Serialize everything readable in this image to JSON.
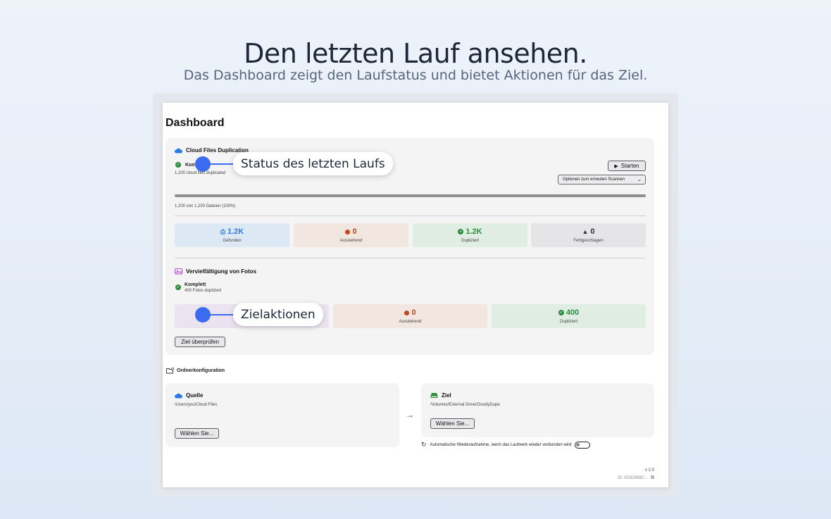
{
  "hero": {
    "title": "Den letzten Lauf ansehen.",
    "subtitle": "Das Dashboard zeigt den Laufstatus und bietet Aktionen für das Ziel."
  },
  "dashboard": {
    "title": "Dashboard",
    "cloud": {
      "title": "Cloud Files Duplication",
      "status": "Kom",
      "detail": "1,200 cloud files duplicated",
      "start_label": "Starten",
      "rescan_label": "Optionen zum erneuten Scannen",
      "progress": 1.0,
      "progress_text": "1,200 von 1,200 Dateien (100%)",
      "stats": [
        {
          "value": "1.2K",
          "label": "Gefunden"
        },
        {
          "value": "0",
          "label": "Ausstehend"
        },
        {
          "value": "1.2K",
          "label": "Dupliziert"
        },
        {
          "value": "0",
          "label": "Fehlgeschlagen"
        }
      ]
    },
    "photos": {
      "title": "Vervielfältigung von Fotos",
      "status": "Komplett",
      "detail": "400 Fotos dupliziert",
      "stats": [
        {
          "value": "0",
          "label": "Ausstehend"
        },
        {
          "value": "400",
          "label": "Dupliziert"
        }
      ],
      "verify_label": "Ziel überprüfen"
    },
    "folders": {
      "title": "Ordnerkonfiguration",
      "source": {
        "title": "Quelle",
        "path": "/Users/you/Cloud Files",
        "choose_label": "Wählen Sie..."
      },
      "target": {
        "title": "Ziel",
        "path": "/Volumes/External Drive/CloudyDupe",
        "choose_label": "Wählen Sie..."
      },
      "auto_resume_label": "Automatische Wiederaufnahme, wenn das Laufwerk wieder verbunden wird",
      "auto_resume_on": false
    },
    "footer": {
      "version": "v 2.0",
      "id": "ID: 0C62658C..."
    }
  },
  "callouts": {
    "status": "Status des letzten Laufs",
    "actions": "Zielaktionen"
  },
  "colors": {
    "found_bg": "#dde8f5",
    "found_fg": "#2c7be5",
    "pending_bg": "#f2e6e1",
    "pending_fg": "#c2471c",
    "done_bg": "#e0ede2",
    "done_fg": "#2e8b3e",
    "failed_bg": "#e5e5e7",
    "failed_fg": "#333333",
    "accent": "#3b6cf0"
  }
}
